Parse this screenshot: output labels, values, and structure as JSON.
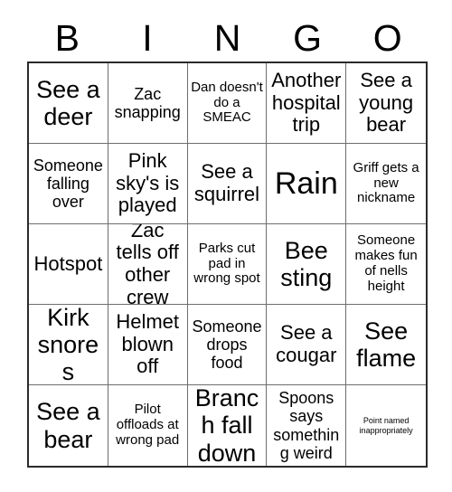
{
  "card": {
    "headers": [
      "B",
      "I",
      "N",
      "G",
      "O"
    ],
    "rows": [
      [
        {
          "text": "See a deer",
          "size": "xl"
        },
        {
          "text": "Zac snapping",
          "size": "md"
        },
        {
          "text": "Dan doesn't do a SMEAC",
          "size": "sm"
        },
        {
          "text": "Another hospital trip",
          "size": "lg"
        },
        {
          "text": "See a young bear",
          "size": "lg"
        }
      ],
      [
        {
          "text": "Someone falling over",
          "size": "md"
        },
        {
          "text": "Pink sky's is played",
          "size": "lg"
        },
        {
          "text": "See a squirrel",
          "size": "lg"
        },
        {
          "text": "Rain",
          "size": "xxl"
        },
        {
          "text": "Griff gets a new nickname",
          "size": "sm"
        }
      ],
      [
        {
          "text": "Hotspot",
          "size": "lg"
        },
        {
          "text": "Zac tells off other crew",
          "size": "lg"
        },
        {
          "text": "Parks cut pad in wrong spot",
          "size": "sm"
        },
        {
          "text": "Bee sting",
          "size": "xl"
        },
        {
          "text": "Someone makes fun of nells height",
          "size": "sm"
        }
      ],
      [
        {
          "text": "Kirk snores",
          "size": "xl"
        },
        {
          "text": "Helmet blown off",
          "size": "lg"
        },
        {
          "text": "Someone drops food",
          "size": "md"
        },
        {
          "text": "See a cougar",
          "size": "lg"
        },
        {
          "text": "See flame",
          "size": "xl"
        }
      ],
      [
        {
          "text": "See a bear",
          "size": "xl"
        },
        {
          "text": "Pilot offloads at wrong pad",
          "size": "sm"
        },
        {
          "text": "Branch fall down",
          "size": "xl"
        },
        {
          "text": "Spoons says something weird",
          "size": "md"
        },
        {
          "text": "Point named inappropriately",
          "size": "xxs"
        }
      ]
    ]
  }
}
